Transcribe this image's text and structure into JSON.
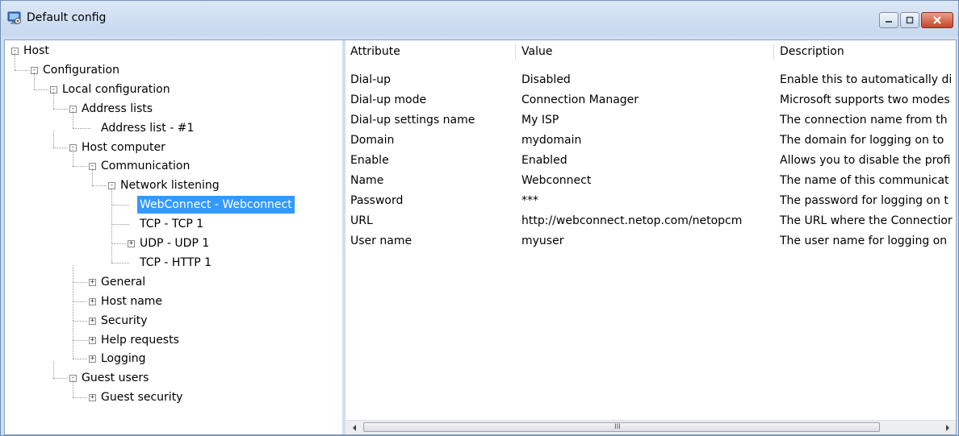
{
  "window": {
    "title": "Default config",
    "icon": "config-computer-icon",
    "buttons": [
      "minimize-icon",
      "maximize-icon",
      "close-icon"
    ]
  },
  "tree": {
    "nodes": [
      {
        "label": "Host",
        "level": 0,
        "expander": "−"
      },
      {
        "label": "Configuration",
        "level": 1,
        "expander": "−"
      },
      {
        "label": "Local configuration",
        "level": 2,
        "expander": "−"
      },
      {
        "label": "Address lists",
        "level": 3,
        "expander": "−"
      },
      {
        "label": "Address list - #1",
        "level": 4,
        "expander": ""
      },
      {
        "label": "Host computer",
        "level": 3,
        "expander": "−"
      },
      {
        "label": "Communication",
        "level": 4,
        "expander": "−"
      },
      {
        "label": "Network listening",
        "level": 5,
        "expander": "−"
      },
      {
        "label": "WebConnect - Webconnect",
        "level": 6,
        "expander": "",
        "selected": true
      },
      {
        "label": "TCP - TCP 1",
        "level": 6,
        "expander": ""
      },
      {
        "label": "UDP - UDP 1",
        "level": 6,
        "expander": "+"
      },
      {
        "label": "TCP - HTTP 1",
        "level": 6,
        "expander": ""
      },
      {
        "label": "General",
        "level": 4,
        "expander": "+"
      },
      {
        "label": "Host name",
        "level": 4,
        "expander": "+"
      },
      {
        "label": "Security",
        "level": 4,
        "expander": "+"
      },
      {
        "label": "Help requests",
        "level": 4,
        "expander": "+"
      },
      {
        "label": "Logging",
        "level": 4,
        "expander": "+"
      },
      {
        "label": "Guest users",
        "level": 3,
        "expander": "−"
      },
      {
        "label": "Guest security",
        "level": 4,
        "expander": "+"
      }
    ]
  },
  "grid": {
    "columns": [
      "Attribute",
      "Value",
      "Description"
    ],
    "rows": [
      [
        "Dial-up",
        "Disabled",
        "Enable this to automatically di"
      ],
      [
        "Dial-up mode",
        "Connection Manager",
        "Microsoft supports two modes"
      ],
      [
        "Dial-up settings name",
        "My ISP",
        "The connection name from th"
      ],
      [
        "Domain",
        "mydomain",
        "The domain for logging on to"
      ],
      [
        "Enable",
        "Enabled",
        "Allows you to disable the profi"
      ],
      [
        "Name",
        "Webconnect",
        "The name of this communicat"
      ],
      [
        "Password",
        "***",
        "The password for logging on t"
      ],
      [
        "URL",
        "http://webconnect.netop.com/netopcm",
        "The URL where the Connectior"
      ],
      [
        "User name",
        "myuser",
        "The user name for logging on"
      ]
    ],
    "scroll_grip": "III"
  },
  "colors": {
    "selection": "#3399ff",
    "frame": "#cfdff0"
  }
}
